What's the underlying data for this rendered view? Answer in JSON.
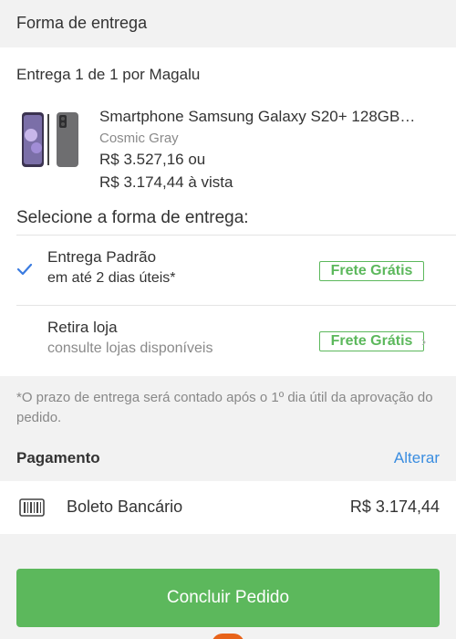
{
  "header": {
    "title": "Forma de entrega"
  },
  "delivery": {
    "label": "Entrega 1 de 1 por Magalu"
  },
  "product": {
    "name": "Smartphone Samsung Galaxy S20+ 128GB…",
    "variant": "Cosmic Gray",
    "price": "R$ 3.527,16 ou",
    "cash_price": "R$ 3.174,44 à vista"
  },
  "shipping": {
    "title": "Selecione a forma de entrega:",
    "options": [
      {
        "title": "Entrega Padrão",
        "subtitle": "em até 2 dias úteis*",
        "badge": "Frete Grátis",
        "selected": true
      },
      {
        "title": "Retira loja",
        "subtitle": "consulte lojas disponíveis",
        "badge": "Frete Grátis",
        "selected": false
      }
    ],
    "note": "*O prazo de entrega será contado após o 1º dia útil da aprovação do pedido."
  },
  "payment": {
    "header": "Pagamento",
    "change_label": "Alterar",
    "method": "Boleto Bancário",
    "amount": "R$ 3.174,44"
  },
  "actions": {
    "submit_label": "Concluir Pedido"
  },
  "colors": {
    "accent_green": "#5cb85c",
    "link_blue": "#3a8de0",
    "check_blue": "#3a7be0",
    "text_gray": "#8a8a8a"
  }
}
